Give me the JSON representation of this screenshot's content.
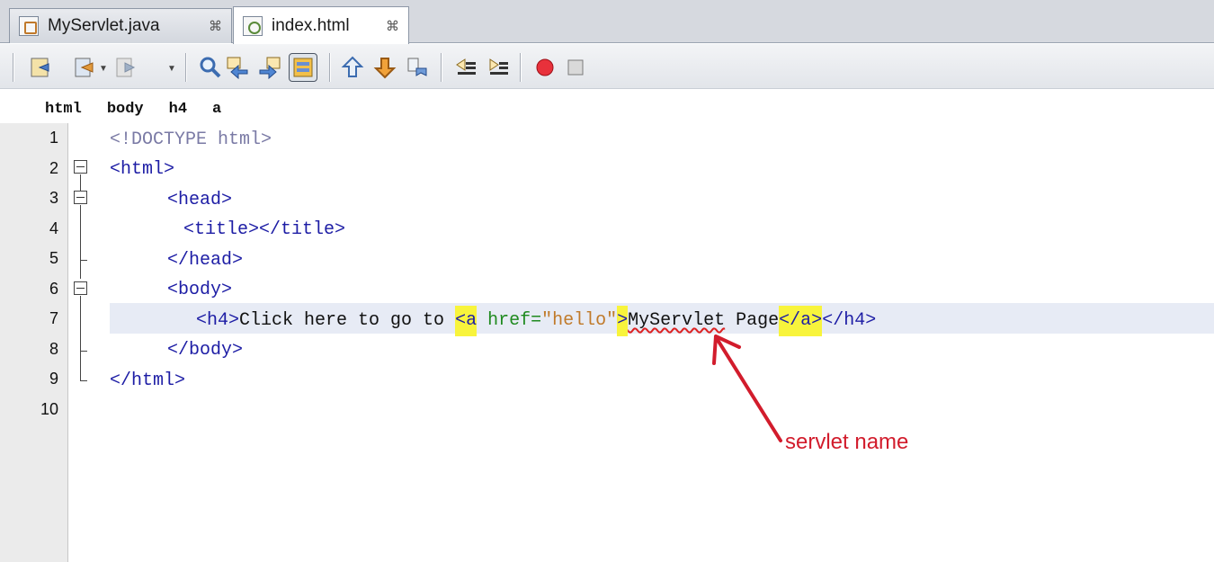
{
  "tabs": [
    {
      "label": "MyServlet.java",
      "close": "⌘"
    },
    {
      "label": "index.html",
      "close": "⌘"
    }
  ],
  "breadcrumb": [
    "html",
    "body",
    "h4",
    "a"
  ],
  "line_numbers": [
    "1",
    "2",
    "3",
    "4",
    "5",
    "6",
    "7",
    "8",
    "9",
    "10"
  ],
  "code": {
    "l1": "<!DOCTYPE html>",
    "l2": "<html>",
    "l3": "<head>",
    "l4": "<title></title>",
    "l5": "</head>",
    "l6": "<body>",
    "l7_open": "<h4>",
    "l7_text": "Click here to go to ",
    "l7_a_open": "<a",
    "l7_attr": " href=",
    "l7_val": "\"hello\"",
    "l7_gt": ">",
    "l7_link_text1": "MyServlet",
    "l7_link_text2": " Page",
    "l7_a_close": "</a>",
    "l7_close": "</h4>",
    "l8": "</body>",
    "l9": "</html>"
  },
  "annotation": {
    "text": "servlet name",
    "color": "#d21c2c"
  },
  "colors": {
    "tag": "#1d1da5",
    "attr": "#1f8a1f",
    "value": "#c07a2a",
    "highlight": "#f8f43c",
    "current_line": "#e7ebf5"
  },
  "toolbar_icons": [
    "back-in-history-icon",
    "last-edit-icon",
    "forward-icon",
    "find-selection-icon",
    "find-previous-icon",
    "find-next-icon",
    "toggle-highlight-search-icon",
    "previous-bookmark-icon",
    "next-bookmark-icon",
    "toggle-bookmark-icon",
    "shift-left-icon",
    "shift-right-icon",
    "start-macro-recording-icon",
    "stop-macro-recording-icon"
  ]
}
